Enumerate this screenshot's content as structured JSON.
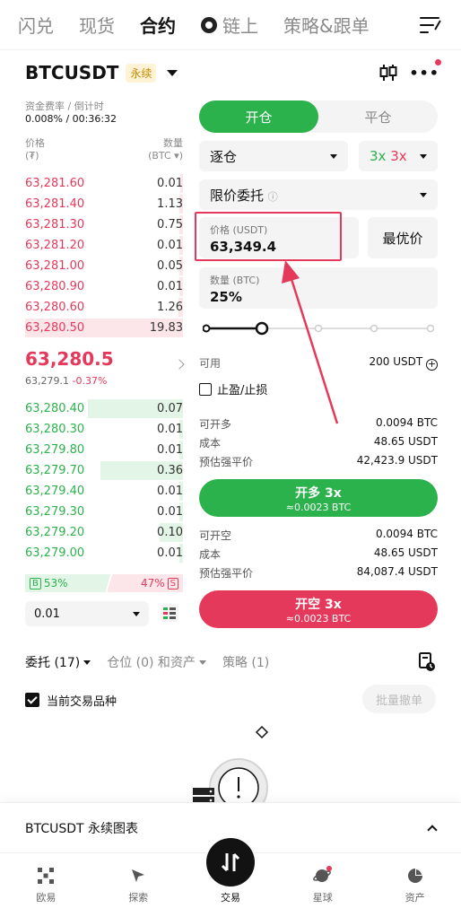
{
  "topnav": {
    "items": [
      "闪兑",
      "现货",
      "合约",
      "链上",
      "策略&跟单"
    ]
  },
  "symbol": {
    "name": "BTCUSDT",
    "tag": "永续"
  },
  "funding": {
    "label": "资金费率 / 倒计时",
    "value": "0.008% / 00:36:32"
  },
  "orderbook": {
    "price_label": "价格",
    "price_unit": "(₮)",
    "qty_label": "数量",
    "qty_unit": "(BTC ▾)",
    "asks": [
      [
        "63,281.60",
        "0.01"
      ],
      [
        "63,281.40",
        "1.13"
      ],
      [
        "63,281.30",
        "0.75"
      ],
      [
        "63,281.20",
        "0.01"
      ],
      [
        "63,281.00",
        "0.05"
      ],
      [
        "63,280.90",
        "0.01"
      ],
      [
        "63,280.60",
        "1.26"
      ],
      [
        "63,280.50",
        "19.83"
      ]
    ],
    "last_price": "63,280.5",
    "mark_price": "63,279.1",
    "change": "-0.37%",
    "bids": [
      [
        "63,280.40",
        "0.07"
      ],
      [
        "63,280.30",
        "0.01"
      ],
      [
        "63,279.80",
        "0.01"
      ],
      [
        "63,279.70",
        "0.36"
      ],
      [
        "63,279.40",
        "0.01"
      ],
      [
        "63,279.30",
        "0.01"
      ],
      [
        "63,279.20",
        "0.10"
      ],
      [
        "63,279.00",
        "0.01"
      ]
    ],
    "buy_label": "B",
    "buy_pct": "53%",
    "sell_label": "S",
    "sell_pct": "47%",
    "precision": "0.01"
  },
  "form": {
    "tab_open": "开仓",
    "tab_close": "平仓",
    "margin_mode": "逐仓",
    "lev_long": "3x",
    "lev_short": "3x",
    "order_type": "限价委托",
    "price_label": "价格 (USDT)",
    "price_value": "63,349.4",
    "best_price": "最优价",
    "qty_label": "数量 (BTC)",
    "qty_value": "25%",
    "avail_label": "可用",
    "avail_value": "200 USDT",
    "tpsl": "止盈/止损",
    "long_info": [
      [
        "可开多",
        "0.0094 BTC"
      ],
      [
        "成本",
        "48.65 USDT"
      ],
      [
        "预估强平价",
        "42,423.9 USDT"
      ]
    ],
    "long_btn": "开多 3x",
    "long_sub": "≈0.0023 BTC",
    "short_info": [
      [
        "可开空",
        "0.0094 BTC"
      ],
      [
        "成本",
        "48.65 USDT"
      ],
      [
        "预估强平价",
        "84,087.4 USDT"
      ]
    ],
    "short_btn": "开空 3x",
    "short_sub": "≈0.0023 BTC"
  },
  "orders": {
    "tab1": "委托 (17)",
    "tab2": "仓位 (0) 和资产",
    "tab3": "策略 (1)",
    "filter": "当前交易品种",
    "batch": "批量撤单"
  },
  "chartbar": {
    "label": "BTCUSDT 永续图表"
  },
  "bottomnav": [
    "欧易",
    "探索",
    "交易",
    "星球",
    "资产"
  ],
  "colors": {
    "green": "#2bb24c",
    "red": "#e5395b"
  }
}
